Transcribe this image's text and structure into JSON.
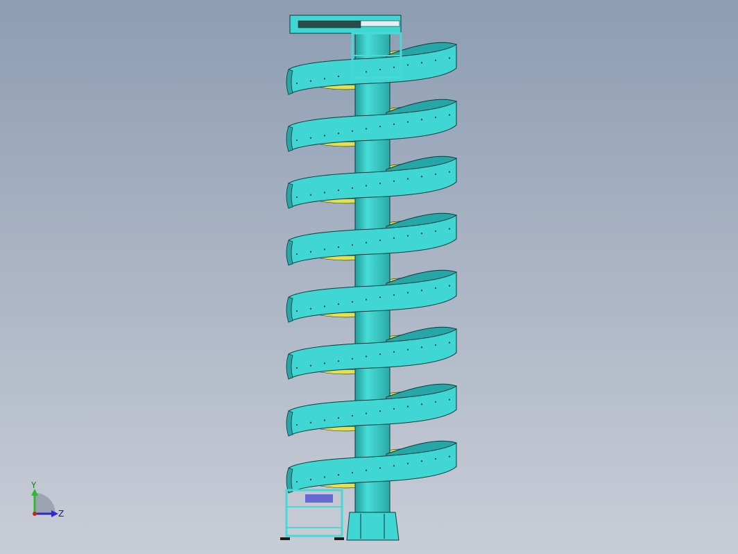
{
  "viewport": {
    "background_top": "#8e9db3",
    "background_bottom": "#c8ccd6"
  },
  "model": {
    "description_icon": "spiral-conveyor-model",
    "body_color": "#3fd6d3",
    "body_shade": "#26a6a6",
    "edge_color": "#0e3a3a",
    "roller_color": "#e8e04a",
    "frame_color": "#47d9d6"
  },
  "triad": {
    "x_label": "",
    "y_label": "Y",
    "z_label": "Z",
    "y_color": "#2dbb2d",
    "z_color": "#2a2ad0",
    "origin_color": "#d02020"
  }
}
